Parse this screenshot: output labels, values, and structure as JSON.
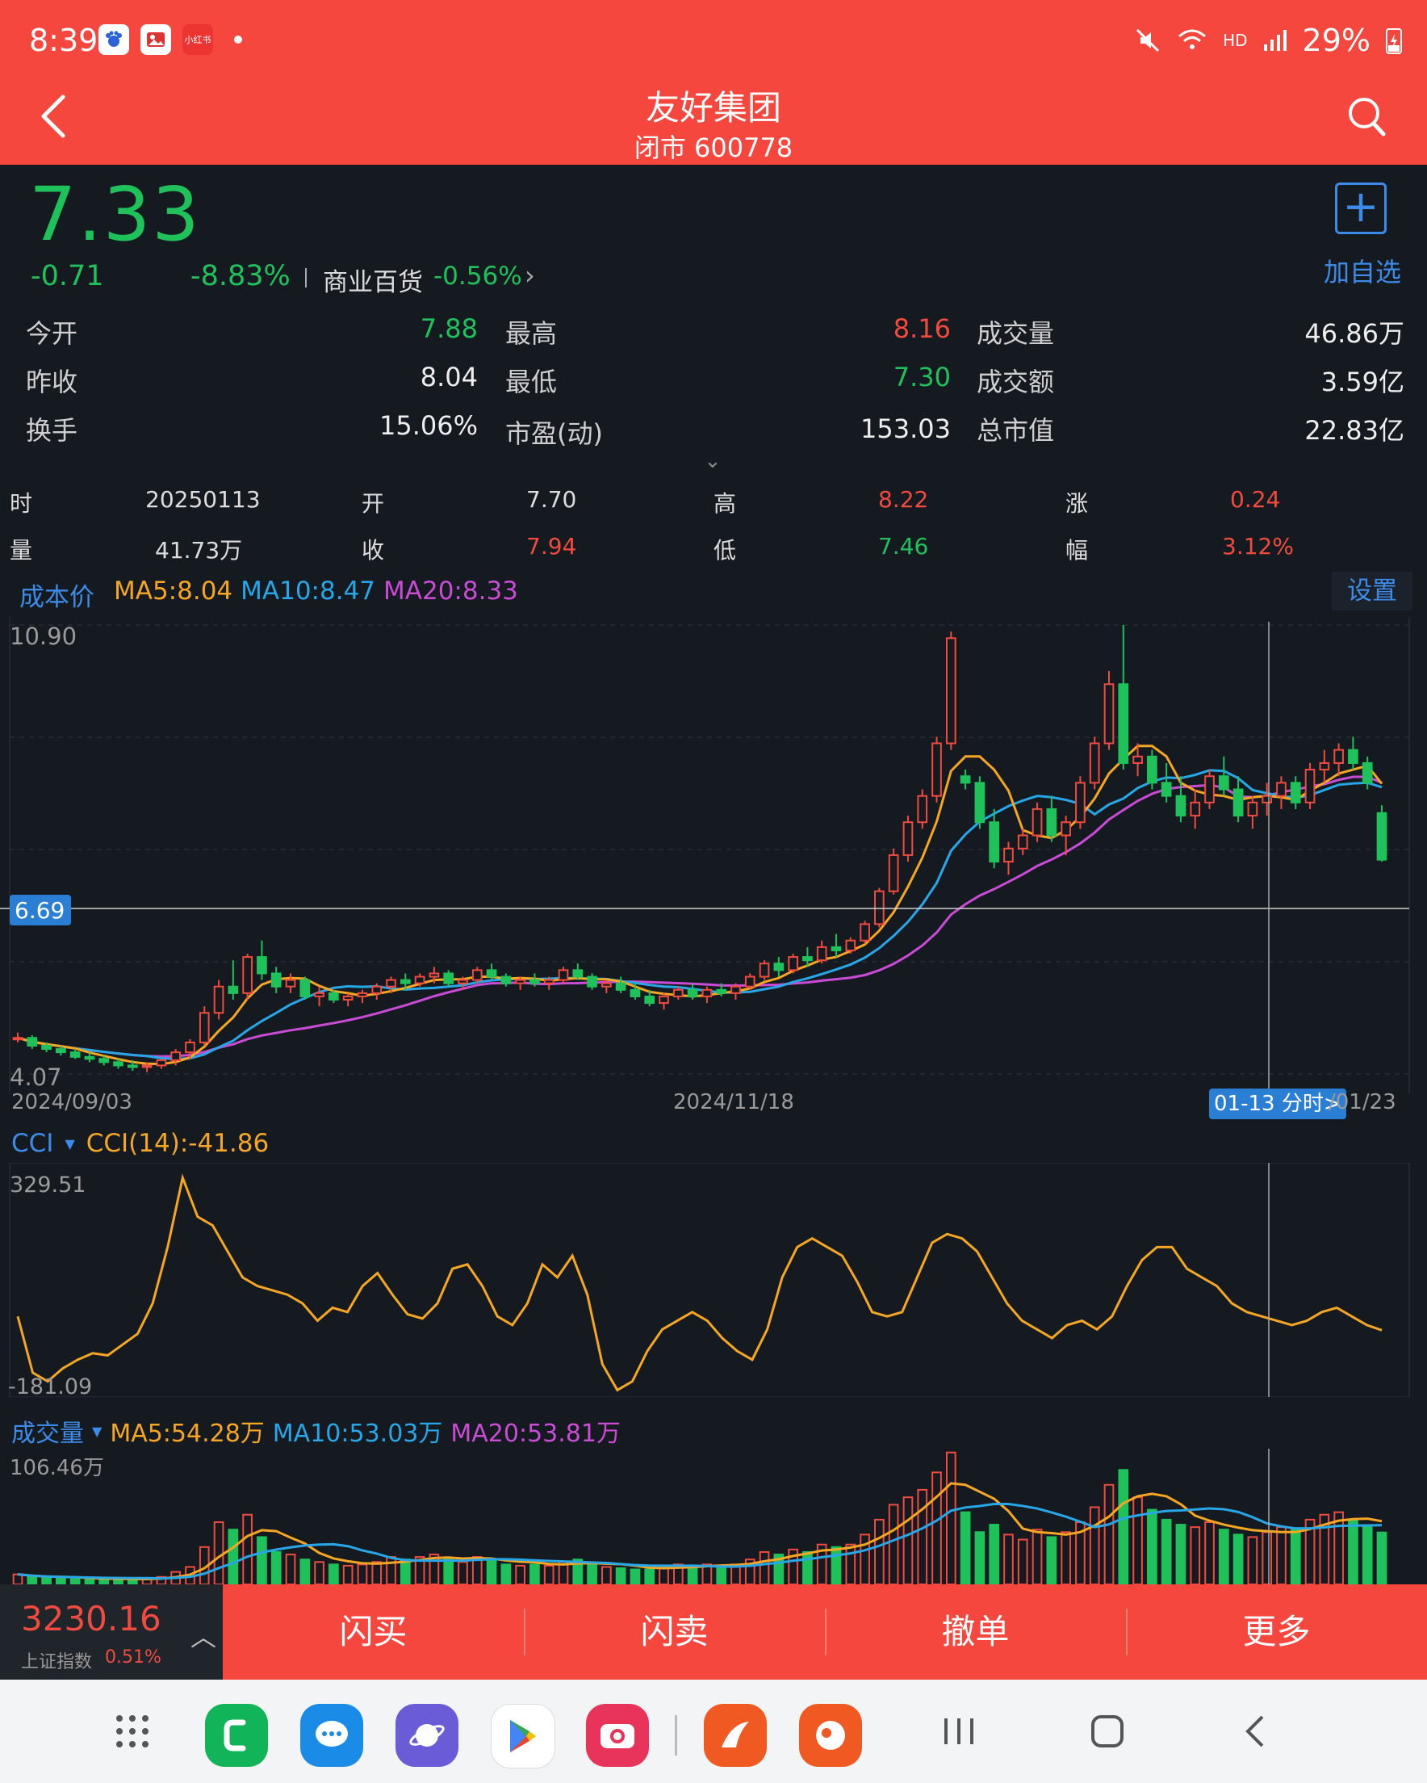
{
  "status_bar": {
    "time": "8:39",
    "network": "HD",
    "battery": "29%",
    "notif_icons": [
      "baidu-icon",
      "gallery-icon",
      "app-badge-icon"
    ],
    "notif_badge_text": "小红书"
  },
  "header": {
    "title": "友好集团",
    "subtitle": "闭市 600778"
  },
  "quote": {
    "price": "7.33",
    "change": "-0.71",
    "change_pct": "-8.83%",
    "sector": "商业百货",
    "sector_pct": "-0.56%",
    "add_label": "加自选"
  },
  "stats": [
    {
      "label": "今开",
      "value": "7.88",
      "color": "green"
    },
    {
      "label": "最高",
      "value": "8.16",
      "color": "red"
    },
    {
      "label": "成交量",
      "value": "46.86万",
      "color": "white"
    },
    {
      "label": "昨收",
      "value": "8.04",
      "color": "white"
    },
    {
      "label": "最低",
      "value": "7.30",
      "color": "green"
    },
    {
      "label": "成交额",
      "value": "3.59亿",
      "color": "white"
    },
    {
      "label": "换手",
      "value": "15.06%",
      "color": "white"
    },
    {
      "label": "市盈(动)",
      "value": "153.03",
      "color": "white"
    },
    {
      "label": "总市值",
      "value": "22.83亿",
      "color": "white"
    }
  ],
  "candle_info": {
    "date_label": "时",
    "date": "20250113",
    "open_label": "开",
    "open": "7.70",
    "high_label": "高",
    "high": "8.22",
    "rise_label": "涨",
    "rise": "0.24",
    "vol_label": "量",
    "vol": "41.73万",
    "close_label": "收",
    "close": "7.94",
    "low_label": "低",
    "low": "7.46",
    "amp_label": "幅",
    "amp": "3.12%"
  },
  "ma_legend": {
    "cost_label": "成本价",
    "ma5": "MA5:8.04",
    "ma10": "MA10:8.47",
    "ma20": "MA20:8.33",
    "settings": "设置"
  },
  "price_chart": {
    "y_max": "10.90",
    "y_min": "4.07",
    "cursor_price": "6.69",
    "x_start": "2024/09/03",
    "x_mid": "2024/11/18",
    "x_end": "/01/23",
    "cursor_badge": "01-13 分时>"
  },
  "cci": {
    "label": "CCI",
    "value": "CCI(14):-41.86",
    "y_max": "329.51",
    "y_min": "-181.09"
  },
  "volume": {
    "label": "成交量",
    "ma5": "MA5:54.28万",
    "ma10": "MA10:53.03万",
    "ma20": "MA20:53.81万",
    "y_max": "106.46万"
  },
  "bottom": {
    "index_value": "3230.16",
    "index_name": "上证指数",
    "index_pct": "0.51%",
    "buttons": [
      "闪买",
      "闪卖",
      "撤单",
      "更多"
    ]
  },
  "colors": {
    "up": "#f04b3e",
    "down": "#1fc25a",
    "accent": "#3d8be8",
    "header": "#f5473e",
    "ma5": "#f5a623",
    "ma10": "#27a7e8",
    "ma20": "#c94bd6"
  },
  "chart_data": [
    {
      "type": "candlestick",
      "title": "",
      "ylim": [
        4.07,
        10.9
      ],
      "x_ticks": [
        "2024/09/03",
        "2024/11/18",
        "/01/23"
      ],
      "series": [
        {
          "name": "K",
          "ohlc": [
            [
              4.6,
              4.7,
              4.55,
              4.62
            ],
            [
              4.62,
              4.66,
              4.45,
              4.5
            ],
            [
              4.5,
              4.55,
              4.4,
              4.45
            ],
            [
              4.45,
              4.5,
              4.35,
              4.4
            ],
            [
              4.4,
              4.45,
              4.3,
              4.33
            ],
            [
              4.33,
              4.4,
              4.25,
              4.3
            ],
            [
              4.3,
              4.35,
              4.2,
              4.25
            ],
            [
              4.25,
              4.3,
              4.15,
              4.2
            ],
            [
              4.2,
              4.28,
              4.12,
              4.18
            ],
            [
              4.18,
              4.25,
              4.1,
              4.2
            ],
            [
              4.2,
              4.3,
              4.15,
              4.28
            ],
            [
              4.28,
              4.45,
              4.2,
              4.4
            ],
            [
              4.4,
              4.6,
              4.3,
              4.55
            ],
            [
              4.55,
              5.1,
              4.5,
              5.0
            ],
            [
              5.0,
              5.5,
              4.9,
              5.4
            ],
            [
              5.4,
              5.8,
              5.2,
              5.3
            ],
            [
              5.3,
              5.9,
              5.2,
              5.85
            ],
            [
              5.85,
              6.1,
              5.5,
              5.6
            ],
            [
              5.6,
              5.7,
              5.3,
              5.4
            ],
            [
              5.4,
              5.6,
              5.3,
              5.5
            ],
            [
              5.5,
              5.55,
              5.2,
              5.25
            ],
            [
              5.25,
              5.4,
              5.1,
              5.3
            ],
            [
              5.3,
              5.35,
              5.15,
              5.2
            ],
            [
              5.2,
              5.3,
              5.1,
              5.25
            ],
            [
              5.25,
              5.35,
              5.15,
              5.3
            ],
            [
              5.3,
              5.45,
              5.2,
              5.4
            ],
            [
              5.4,
              5.55,
              5.3,
              5.5
            ],
            [
              5.5,
              5.6,
              5.35,
              5.45
            ],
            [
              5.45,
              5.6,
              5.4,
              5.55
            ],
            [
              5.55,
              5.7,
              5.45,
              5.6
            ],
            [
              5.6,
              5.65,
              5.4,
              5.45
            ],
            [
              5.45,
              5.55,
              5.35,
              5.5
            ],
            [
              5.5,
              5.7,
              5.45,
              5.65
            ],
            [
              5.65,
              5.75,
              5.5,
              5.55
            ],
            [
              5.55,
              5.6,
              5.4,
              5.45
            ],
            [
              5.45,
              5.55,
              5.35,
              5.5
            ],
            [
              5.5,
              5.6,
              5.4,
              5.45
            ],
            [
              5.45,
              5.55,
              5.35,
              5.5
            ],
            [
              5.5,
              5.7,
              5.45,
              5.65
            ],
            [
              5.65,
              5.75,
              5.5,
              5.55
            ],
            [
              5.55,
              5.6,
              5.35,
              5.4
            ],
            [
              5.4,
              5.5,
              5.3,
              5.45
            ],
            [
              5.45,
              5.55,
              5.3,
              5.35
            ],
            [
              5.35,
              5.45,
              5.2,
              5.25
            ],
            [
              5.25,
              5.35,
              5.1,
              5.15
            ],
            [
              5.15,
              5.3,
              5.05,
              5.25
            ],
            [
              5.25,
              5.4,
              5.2,
              5.35
            ],
            [
              5.35,
              5.45,
              5.2,
              5.25
            ],
            [
              5.25,
              5.4,
              5.15,
              5.35
            ],
            [
              5.35,
              5.45,
              5.25,
              5.3
            ],
            [
              5.3,
              5.45,
              5.2,
              5.4
            ],
            [
              5.4,
              5.6,
              5.35,
              5.55
            ],
            [
              5.55,
              5.8,
              5.5,
              5.75
            ],
            [
              5.75,
              5.85,
              5.55,
              5.65
            ],
            [
              5.65,
              5.9,
              5.6,
              5.85
            ],
            [
              5.85,
              6.0,
              5.7,
              5.8
            ],
            [
              5.8,
              6.1,
              5.75,
              6.0
            ],
            [
              6.0,
              6.2,
              5.85,
              5.95
            ],
            [
              5.95,
              6.15,
              5.9,
              6.1
            ],
            [
              6.1,
              6.4,
              6.05,
              6.35
            ],
            [
              6.35,
              6.9,
              6.3,
              6.85
            ],
            [
              6.85,
              7.5,
              6.8,
              7.4
            ],
            [
              7.4,
              8.0,
              7.3,
              7.9
            ],
            [
              7.9,
              8.4,
              7.8,
              8.3
            ],
            [
              8.3,
              9.2,
              8.2,
              9.1
            ],
            [
              9.1,
              10.8,
              9.0,
              10.7
            ],
            [
              8.6,
              8.7,
              8.4,
              8.5
            ],
            [
              8.5,
              8.6,
              7.8,
              7.9
            ],
            [
              7.9,
              8.1,
              7.2,
              7.3
            ],
            [
              7.3,
              7.6,
              7.1,
              7.5
            ],
            [
              7.5,
              7.8,
              7.4,
              7.7
            ],
            [
              7.7,
              8.2,
              7.6,
              8.1
            ],
            [
              8.1,
              8.3,
              7.6,
              7.7
            ],
            [
              7.7,
              8.0,
              7.4,
              7.9
            ],
            [
              7.9,
              8.6,
              7.8,
              8.5
            ],
            [
              8.5,
              9.2,
              8.4,
              9.1
            ],
            [
              9.1,
              10.2,
              9.0,
              10.0
            ],
            [
              10.0,
              10.9,
              8.7,
              8.8
            ],
            [
              8.8,
              9.1,
              8.6,
              8.9
            ],
            [
              8.9,
              9.0,
              8.4,
              8.5
            ],
            [
              8.5,
              8.8,
              8.2,
              8.3
            ],
            [
              8.3,
              8.6,
              7.9,
              8.0
            ],
            [
              8.0,
              8.4,
              7.8,
              8.2
            ],
            [
              8.2,
              8.7,
              8.1,
              8.6
            ],
            [
              8.6,
              8.9,
              8.3,
              8.4
            ],
            [
              8.4,
              8.6,
              7.9,
              8.0
            ],
            [
              8.0,
              8.3,
              7.8,
              8.2
            ],
            [
              8.2,
              8.5,
              8.0,
              8.3
            ],
            [
              8.3,
              8.6,
              8.1,
              8.5
            ],
            [
              8.5,
              8.6,
              8.1,
              8.2
            ],
            [
              8.2,
              8.8,
              8.1,
              8.7
            ],
            [
              8.7,
              9.0,
              8.5,
              8.8
            ],
            [
              8.8,
              9.1,
              8.6,
              9.0
            ],
            [
              9.0,
              9.2,
              8.7,
              8.8
            ],
            [
              8.8,
              8.9,
              8.4,
              8.5
            ],
            [
              8.04,
              8.16,
              7.3,
              7.33
            ]
          ]
        }
      ]
    },
    {
      "type": "line",
      "title": "",
      "ylim": [
        -181.09,
        329.51
      ],
      "series": [
        {
          "name": "CCI(14)",
          "values": [
            -10,
            -140,
            -160,
            -130,
            -110,
            -95,
            -100,
            -75,
            -50,
            20,
            150,
            310,
            220,
            200,
            140,
            80,
            60,
            50,
            40,
            20,
            -20,
            10,
            0,
            60,
            90,
            40,
            -5,
            -15,
            20,
            100,
            110,
            60,
            -10,
            -30,
            20,
            110,
            80,
            130,
            40,
            -120,
            -180,
            -160,
            -90,
            -40,
            -20,
            0,
            -20,
            -60,
            -90,
            -110,
            -40,
            80,
            150,
            170,
            150,
            130,
            70,
            0,
            -10,
            0,
            80,
            160,
            180,
            170,
            140,
            80,
            20,
            -20,
            -40,
            -60,
            -30,
            -20,
            -40,
            -10,
            60,
            120,
            150,
            150,
            100,
            80,
            60,
            20,
            0,
            -10,
            -20,
            -30,
            -20,
            0,
            10,
            -10,
            -30,
            -41.86
          ]
        }
      ]
    },
    {
      "type": "bar",
      "title": "",
      "ylim": [
        0,
        106.46
      ],
      "series": [
        {
          "name": "成交量",
          "values": [
            8,
            6,
            5,
            5,
            5,
            4,
            4,
            4,
            4,
            5,
            6,
            10,
            14,
            30,
            50,
            44,
            56,
            38,
            26,
            24,
            20,
            18,
            16,
            15,
            16,
            18,
            22,
            20,
            22,
            24,
            20,
            18,
            22,
            20,
            16,
            15,
            16,
            15,
            18,
            20,
            16,
            14,
            13,
            12,
            12,
            14,
            16,
            15,
            16,
            15,
            16,
            20,
            26,
            24,
            28,
            26,
            32,
            30,
            32,
            40,
            52,
            64,
            70,
            76,
            90,
            106,
            58,
            42,
            48,
            40,
            36,
            44,
            38,
            42,
            50,
            62,
            80,
            92,
            70,
            60,
            52,
            48,
            46,
            50,
            44,
            40,
            38,
            42,
            46,
            44,
            52,
            56,
            58,
            52,
            46,
            41.73
          ]
        }
      ]
    }
  ]
}
